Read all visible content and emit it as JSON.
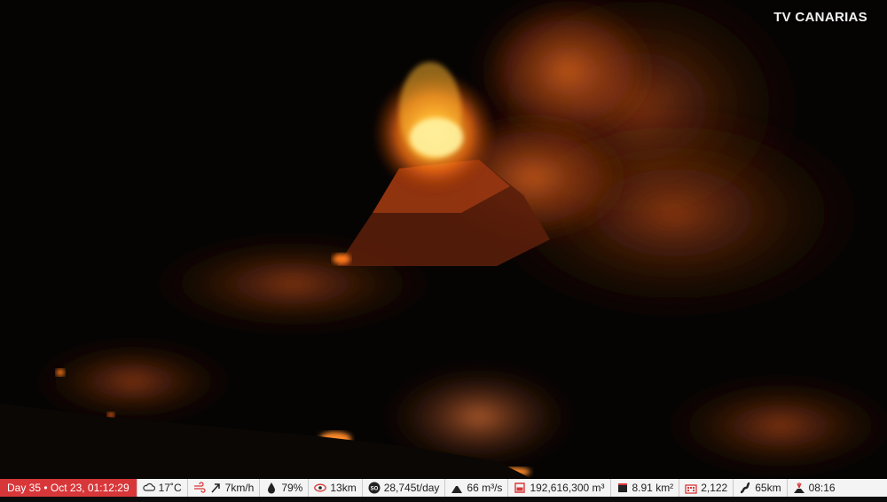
{
  "broadcaster": {
    "logo_text": "TV CANARIAS"
  },
  "scene": {
    "description_icon": "volcano-eruption-image"
  },
  "ticker": {
    "day_label": "Day 35 • Oct 23, 01:12:29",
    "temperature": "17˚C",
    "wind": "7km/h",
    "humidity": "79%",
    "visibility": "13km",
    "so2": "28,745t/day",
    "lava_flow_rate": "66 m³/s",
    "lava_volume": "192,616,300 m³",
    "area": "8.91 km²",
    "buildings": "2,122",
    "lava_length": "65km",
    "time": "08:16"
  },
  "colors": {
    "day_badge": "#d8373a",
    "ticker_bg": "#f4f4f4",
    "lava": "#ff7a1a"
  }
}
